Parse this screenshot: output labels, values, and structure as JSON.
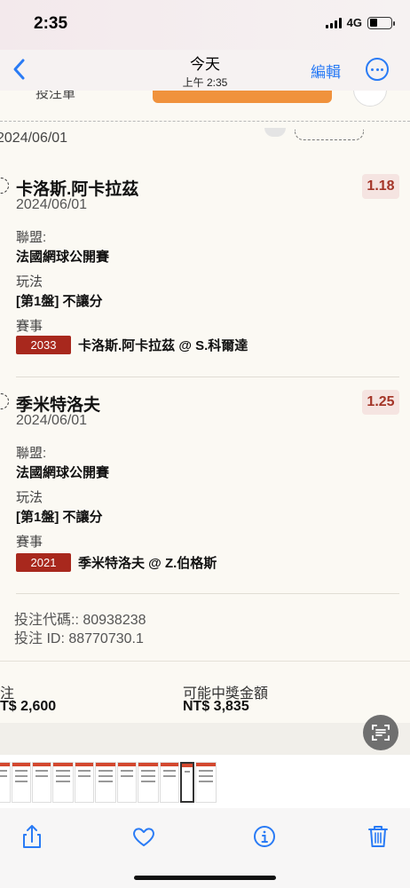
{
  "status_bar": {
    "time": "2:35",
    "network": "4G"
  },
  "nav": {
    "title": "今天",
    "subtitle": "上午 2:35",
    "edit_label": "編輯"
  },
  "receipt": {
    "partial_top_left": "投注單",
    "partial_top_button": "",
    "partial_date": "2024/06/01",
    "selections": [
      {
        "name": "卡洛斯.阿卡拉茲",
        "date": "2024/06/01",
        "odds": "1.18",
        "league_label": "聯盟:",
        "league": "法國網球公開賽",
        "play_label": "玩法",
        "play": "[第1盤] 不讓分",
        "event_label": "賽事",
        "event_id": "2033",
        "event": "卡洛斯.阿卡拉茲 @ S.科爾達"
      },
      {
        "name": "季米特洛夫",
        "date": "2024/06/01",
        "odds": "1.25",
        "league_label": "聯盟:",
        "league": "法國網球公開賽",
        "play_label": "玩法",
        "play": "[第1盤] 不讓分",
        "event_label": "賽事",
        "event_id": "2021",
        "event": "季米特洛夫 @ Z.伯格斯"
      }
    ],
    "bet_code": "投注代碼:: 80938238",
    "bet_id": "投注 ID: 88770730.1",
    "stake_label": "注",
    "stake_value": "T$ 2,600",
    "payout_label": "可能中獎金額",
    "payout_value": "NT$ 3,835"
  },
  "toolbar": {
    "share_icon": "share-icon",
    "favorite_icon": "heart-icon",
    "info_icon": "info-icon",
    "delete_icon": "trash-icon"
  },
  "colors": {
    "accent": "#2a7bf5",
    "odds": "#a43528",
    "badge": "#a8281d",
    "receipt_bg": "#fbf9f3"
  }
}
